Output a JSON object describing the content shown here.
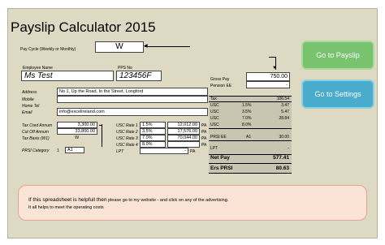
{
  "title": "Payslip Calculator 2015",
  "pay_cycle": {
    "label": "Pay Cycle (Weekly or Monthly)",
    "value": "W"
  },
  "employee": {
    "name_label": "Employee Name",
    "name": "Ms Test",
    "pps_label": "PPS No",
    "pps": "123456F",
    "address_label": "Address",
    "address": "No 1, Up the Road, In the Street, Longford",
    "mobile_label": "Mobile",
    "home_tel_label": "Home Tel",
    "email_label": "Email",
    "email": "info@excelireland.com"
  },
  "tax": {
    "cred_label": "Tax Cred Annum",
    "cred": "3,300.00",
    "cutoff_label": "Cut Off Annum",
    "cutoff": "33,800.00",
    "basis_label": "Tax Basis (W1)",
    "basis": "W"
  },
  "usc_rates": [
    {
      "label": "USC Rate 1",
      "pct": "1.5%",
      "amount": "12,012.00",
      "unit": "PA"
    },
    {
      "label": "USC Rate 2",
      "pct": "3.5%",
      "amount": "17,576.00",
      "unit": "PA"
    },
    {
      "label": "USC Rate 3",
      "pct": "7.0%",
      "amount": "70,044.00",
      "unit": "PA"
    },
    {
      "label": "USC Rate 4",
      "pct": "8.0%",
      "amount": "",
      "unit": "PA"
    }
  ],
  "lpt": {
    "label": "LPT",
    "value": "-",
    "unit": "PA"
  },
  "prsi": {
    "label": "PRSI Category",
    "num": "1",
    "class": "A1"
  },
  "gross": {
    "label": "Gross Pay",
    "value": "750.00",
    "pension_label": "Pension EE",
    "pension": "-"
  },
  "summary": {
    "tax_label": "Tax",
    "tax": "106.54",
    "usc": [
      {
        "label": "USC",
        "pct": "1.5%",
        "value": "3.47"
      },
      {
        "label": "USC",
        "pct": "3.5%",
        "value": "5.47"
      },
      {
        "label": "USC",
        "pct": "7.0%",
        "value": "28.84"
      },
      {
        "label": "USC",
        "pct": "8.0%",
        "value": ""
      }
    ],
    "prsi_label": "PRSI EE",
    "prsi_class": "A1",
    "prsi": "30.00",
    "lpt_label": "LPT",
    "lpt": "-",
    "net_label": "Net Pay",
    "net": "577.41",
    "ers_label": "Ers PRSI",
    "ers": "80.63"
  },
  "buttons": {
    "payslip": "Go to Payslip",
    "settings": "Go to Settings"
  },
  "info": {
    "line1a": "If this spreadsheet is helpfull then",
    "line1b": "please go to my website  - and click on any of the advertising.",
    "line2": "It all helps to meet the operating costs"
  },
  "colors": {
    "sheet": "#ddd9c3",
    "green_button": "#79c36f",
    "teal_button": "#4aaccc",
    "info_box": "#fbe3d6"
  }
}
